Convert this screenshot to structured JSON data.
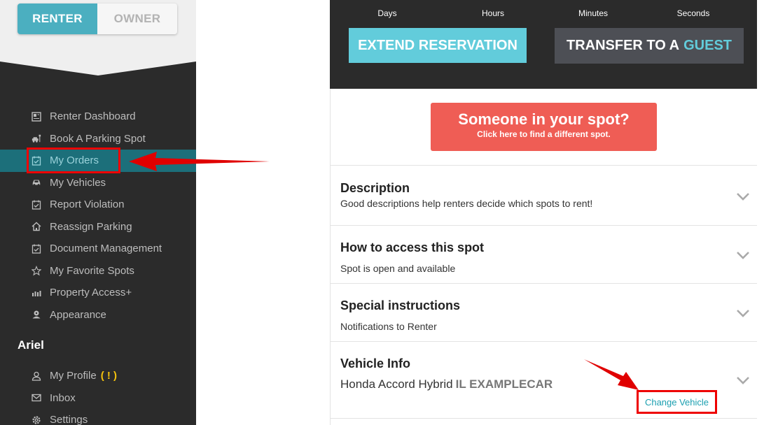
{
  "sidebar": {
    "role_toggle": {
      "renter": "RENTER",
      "owner": "OWNER"
    },
    "items": [
      {
        "label": "Renter Dashboard",
        "icon": "dashboard-icon"
      },
      {
        "label": "Book A Parking Spot",
        "icon": "parking-car-icon"
      },
      {
        "label": "My Orders",
        "icon": "orders-icon"
      },
      {
        "label": "My Vehicles",
        "icon": "car-icon"
      },
      {
        "label": "Report Violation",
        "icon": "report-icon"
      },
      {
        "label": "Reassign Parking",
        "icon": "home-icon"
      },
      {
        "label": "Document Management",
        "icon": "document-icon"
      },
      {
        "label": "My Favorite Spots",
        "icon": "star-icon"
      },
      {
        "label": "Property Access+",
        "icon": "access-icon"
      },
      {
        "label": "Appearance",
        "icon": "palette-icon"
      }
    ],
    "user_name": "Ariel",
    "user_items": [
      {
        "label": "My Profile",
        "badge": "( ! )",
        "icon": "user-icon"
      },
      {
        "label": "Inbox",
        "icon": "mail-icon"
      },
      {
        "label": "Settings",
        "icon": "gear-icon"
      }
    ]
  },
  "countdown": {
    "units": [
      "Days",
      "Hours",
      "Minutes",
      "Seconds"
    ]
  },
  "actions": {
    "extend": "EXTEND RESERVATION",
    "transfer_prefix": "TRANSFER TO A",
    "transfer_accent": "GUEST"
  },
  "spot_banner": {
    "title": "Someone in your spot?",
    "subtitle": "Click here to find a different spot."
  },
  "sections": {
    "description": {
      "title": "Description",
      "text": "Good descriptions help renters decide which spots to rent!"
    },
    "access": {
      "title": "How to access this spot",
      "text": "Spot is open and available"
    },
    "instructions": {
      "title": "Special instructions",
      "text": "Notifications to Renter"
    },
    "vehicle": {
      "title": "Vehicle Info",
      "name": "Honda Accord Hybrid",
      "plate": "IL EXAMPLECAR",
      "change_label": "Change Vehicle"
    }
  },
  "colors": {
    "accent": "#62ccdb",
    "active_nav": "#1c6f7a",
    "banner": "#ef5d55",
    "annotation": "#e00000"
  }
}
